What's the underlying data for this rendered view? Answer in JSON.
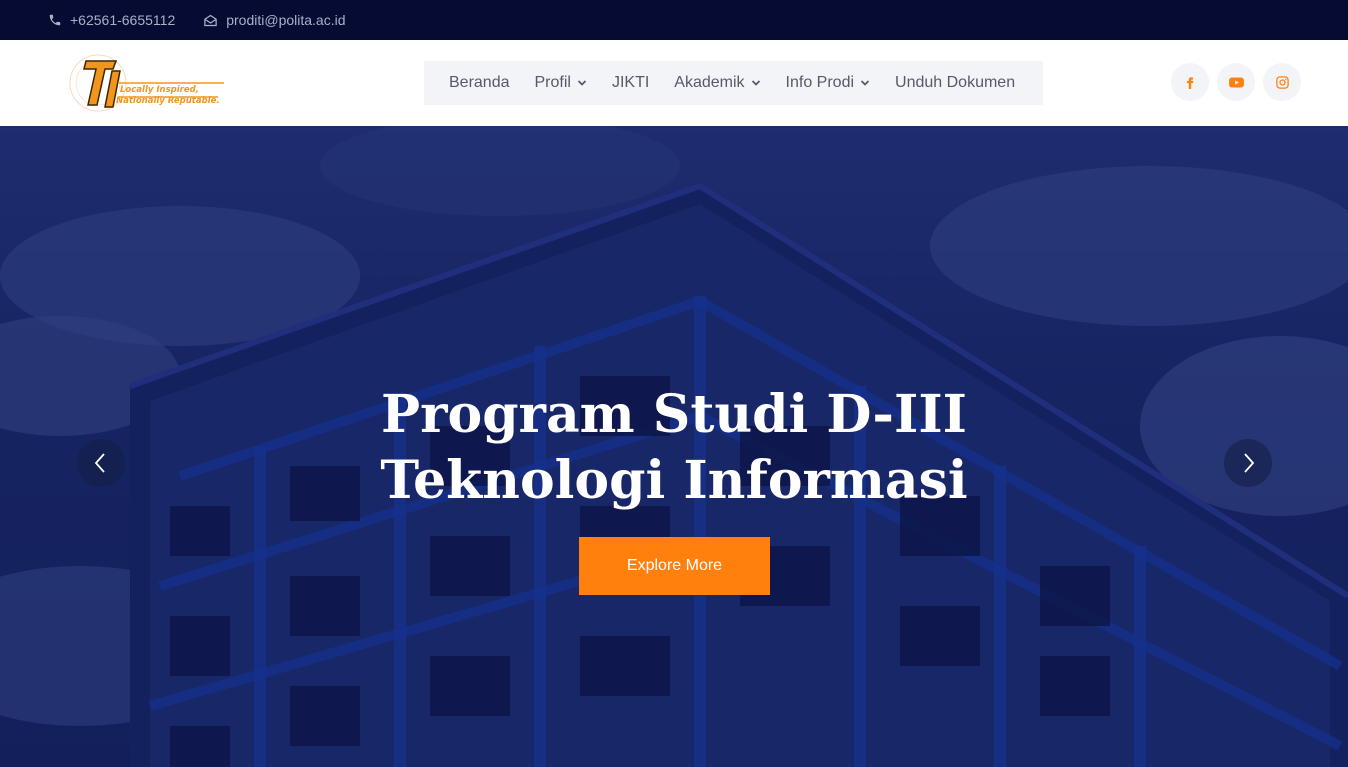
{
  "topbar": {
    "phone": "+62561-6655112",
    "email": "proditi@polita.ac.id",
    "phone_icon": "phone-icon",
    "email_icon": "envelope-open-icon"
  },
  "logo": {
    "mark": "TI",
    "tagline_line1": "Locally Inspired,",
    "tagline_line2": "Nationally Reputable."
  },
  "nav": {
    "items": [
      {
        "label": "Beranda",
        "dropdown": false
      },
      {
        "label": "Profil",
        "dropdown": true
      },
      {
        "label": "JIKTI",
        "dropdown": false
      },
      {
        "label": "Akademik",
        "dropdown": true
      },
      {
        "label": "Info Prodi",
        "dropdown": true
      },
      {
        "label": "Unduh Dokumen",
        "dropdown": false
      }
    ]
  },
  "socials": [
    {
      "icon": "facebook-icon"
    },
    {
      "icon": "youtube-icon"
    },
    {
      "icon": "instagram-icon"
    }
  ],
  "hero": {
    "title_line1": "Program Studi D-III",
    "title_line2": "Teknologi Informasi",
    "cta_label": "Explore More",
    "prev_icon": "chevron-left-icon",
    "next_icon": "chevron-right-icon"
  },
  "colors": {
    "topbar_bg": "#050b33",
    "accent": "#ff800d",
    "nav_bg": "#f3f4f8",
    "hero_tint": "#1e2f72"
  }
}
